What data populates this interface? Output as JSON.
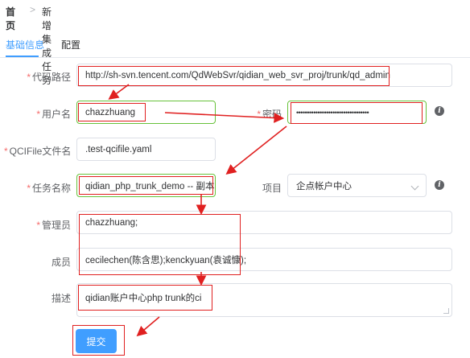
{
  "breadcrumb": {
    "home": "首页",
    "separator": ">",
    "current": "新增集成任务"
  },
  "tabs": [
    {
      "label": "基础信息",
      "active": true
    },
    {
      "label": "配置",
      "active": false
    }
  ],
  "form": {
    "code_path": {
      "label": "代码路径",
      "required": true,
      "value": "http://sh-svn.tencent.com/QdWebSvr/qidian_web_svr_proj/trunk/qd_admin"
    },
    "username": {
      "label": "用户名",
      "required": true,
      "value": "chazzhuang"
    },
    "password": {
      "label": "密码",
      "required": true,
      "value": "••••••••••••••••••••••••••••••••••"
    },
    "qcifile": {
      "label": "QCIFile文件名",
      "required": true,
      "value": ".test-qcifile.yaml"
    },
    "task_name": {
      "label": "任务名称",
      "required": true,
      "value": "qidian_php_trunk_demo -- 副本"
    },
    "project": {
      "label": "项目",
      "required": false,
      "value": "企点帐户中心"
    },
    "admin": {
      "label": "管理员",
      "required": true,
      "value": "chazzhuang;"
    },
    "members": {
      "label": "成员",
      "required": false,
      "value": "cecilechen(陈含思);kenckyuan(袁诚慷);"
    },
    "description": {
      "label": "描述",
      "required": false,
      "value": "qidian账户中心php trunk的ci"
    },
    "submit_label": "提交",
    "info_icon_glyph": "i"
  },
  "colors": {
    "primary": "#409eff",
    "required": "#f56c6c",
    "success_border": "#67c23a",
    "annotation": "#e02020"
  }
}
